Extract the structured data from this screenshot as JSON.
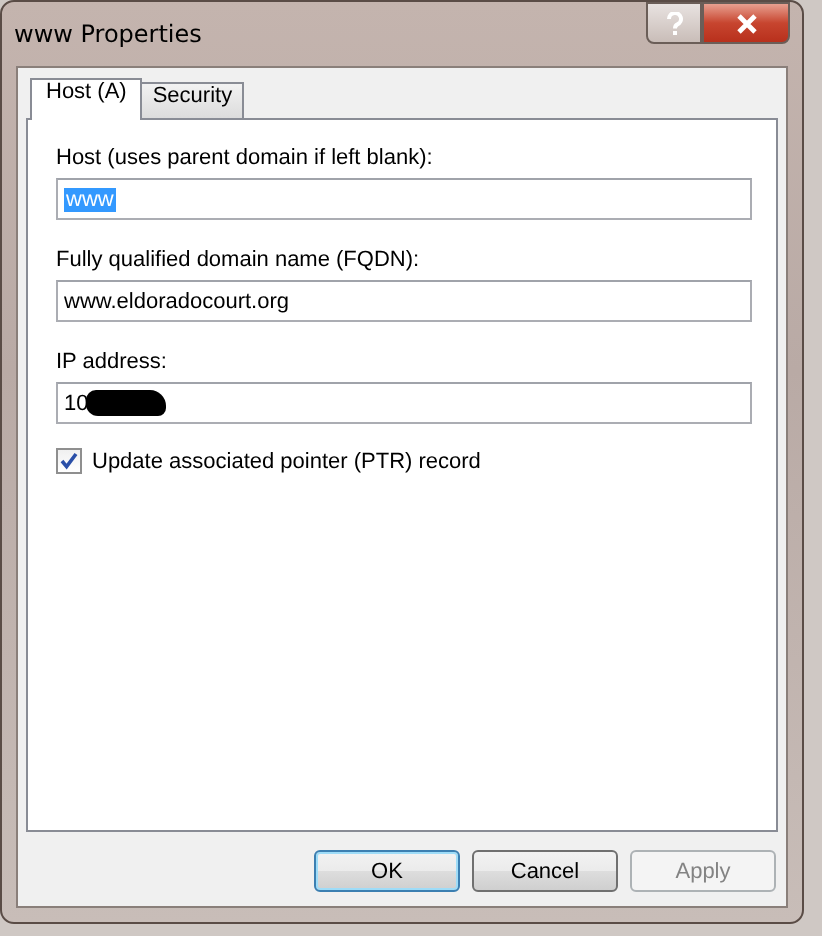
{
  "window": {
    "title": "www Properties"
  },
  "tabs": [
    {
      "label": "Host (A)",
      "selected": true
    },
    {
      "label": "Security",
      "selected": false
    }
  ],
  "fields": [
    {
      "label": "Host (uses parent domain if left blank):",
      "value": "www",
      "text_selected": true,
      "redacted": false
    },
    {
      "label": "Fully qualified domain name (FQDN):",
      "value": "www.eldoradocourt.org",
      "text_selected": false,
      "redacted": false
    },
    {
      "label": "IP address:",
      "value": "10",
      "text_selected": false,
      "redacted": true
    }
  ],
  "checkbox": {
    "label": "Update associated pointer (PTR) record",
    "checked": true
  },
  "buttons": [
    {
      "label": "OK",
      "default": true,
      "disabled": false
    },
    {
      "label": "Cancel",
      "default": false,
      "disabled": false
    },
    {
      "label": "Apply",
      "default": false,
      "disabled": true
    }
  ]
}
